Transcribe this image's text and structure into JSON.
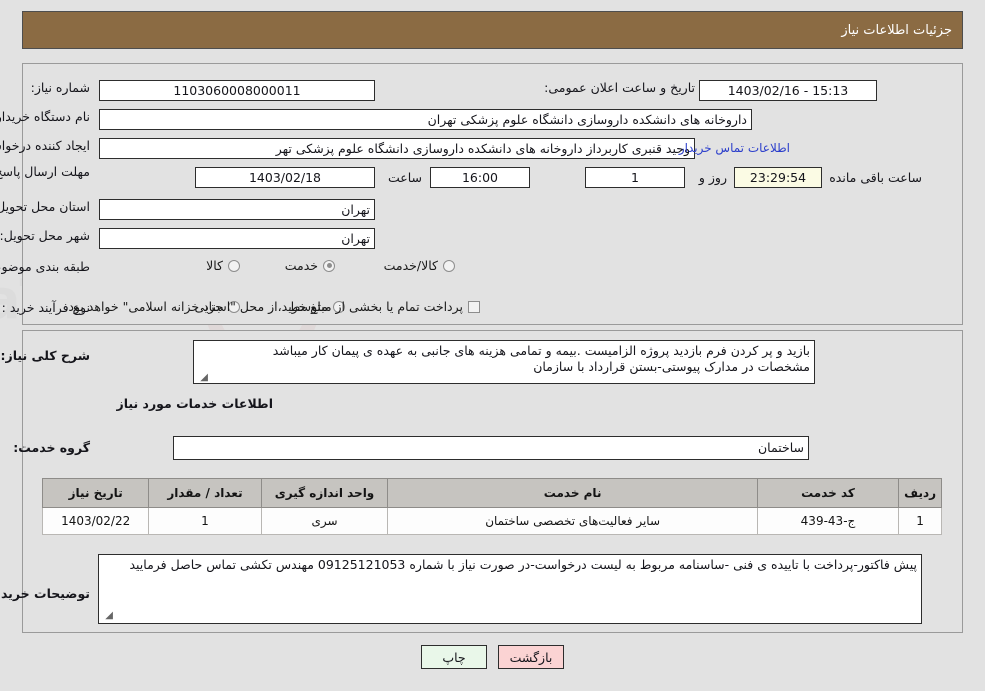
{
  "header": {
    "title": "جزئیات اطلاعات نیاز"
  },
  "top_form": {
    "need_number_label": "شماره نیاز:",
    "need_number_value": "1103060008000011",
    "announce_label": "تاریخ و ساعت اعلان عمومی:",
    "announce_value": "15:13 - 1403/02/16",
    "buyer_org_label": "نام دستگاه خریدار:",
    "buyer_org_value": "داروخانه های دانشکده داروسازی دانشگاه علوم پزشکی تهران",
    "requester_label": "ایجاد کننده درخواست:",
    "requester_value": "وحید قنبری کاربرداز داروخانه های دانشکده داروسازی دانشگاه علوم پزشکی تهر",
    "contact_link": "اطلاعات تماس خریدار",
    "deadline_label": "مهلت ارسال پاسخ: تا تاریخ:",
    "deadline_date": "1403/02/18",
    "deadline_hour_label": "ساعت",
    "deadline_hour": "16:00",
    "days_remaining": "1",
    "days_unit": "روز و",
    "timer": "23:29:54",
    "timer_suffix": "ساعت باقی مانده",
    "province_label": "استان محل تحویل:",
    "province_value": "تهران",
    "city_label": "شهر محل تحویل:",
    "city_value": "تهران",
    "classification_label": "طبقه بندی موضوعی:",
    "classification_options": [
      "کالا",
      "خدمت",
      "کالا/خدمت"
    ],
    "classification_selected": "خدمت",
    "process_label": "نوع فرآیند خرید :",
    "process_options": [
      "جزیی",
      "متوسط"
    ],
    "process_selected": "",
    "treasury_checkbox_label": "پرداخت تمام یا بخشی از مبلغ خرید،از محل \"اسناد خزانه اسلامی\" خواهد بود.",
    "treasury_checked": false
  },
  "description": {
    "label": "شرح کلی نیاز:",
    "value": "بازید و پر کردن فرم بازدید پروژه الزامیست .بیمه و تمامی هزینه های جانبی به عهده ی پیمان کار میباشد\nمشخصات در مدارک پیوستی-بستن قرارداد با سازمان"
  },
  "services_section": {
    "title": "اطلاعات خدمات مورد نیاز",
    "group_label": "گروه خدمت:",
    "group_value": "ساختمان",
    "table": {
      "headers": [
        "ردیف",
        "کد خدمت",
        "نام خدمت",
        "واحد اندازه گیری",
        "تعداد / مقدار",
        "تاریخ نیاز"
      ],
      "rows": [
        [
          "1",
          "ج-43-439",
          "سایر فعالیت‌های تخصصی ساختمان",
          "سری",
          "1",
          "1403/02/22"
        ]
      ]
    }
  },
  "buyer_notes": {
    "label": "توضیحات خریدار:",
    "value": "پیش فاکتور-پرداخت با تاییده ی فنی -ساسنامه مربوط به لیست درخواست-در صورت نیاز با شماره 09125121053 مهندس تکشی تماس حاصل فرمایید"
  },
  "buttons": {
    "print": "چاپ",
    "back": "بازگشت"
  },
  "colors": {
    "header_bg": "#8b6b43",
    "page_bg": "#e2e2e2",
    "link": "#2b3ecb",
    "timer_bg": "#fbfbe4",
    "print_bg": "#e9f7e9",
    "back_bg": "#fbd3d3",
    "table_header_bg": "#c6c4c0"
  }
}
